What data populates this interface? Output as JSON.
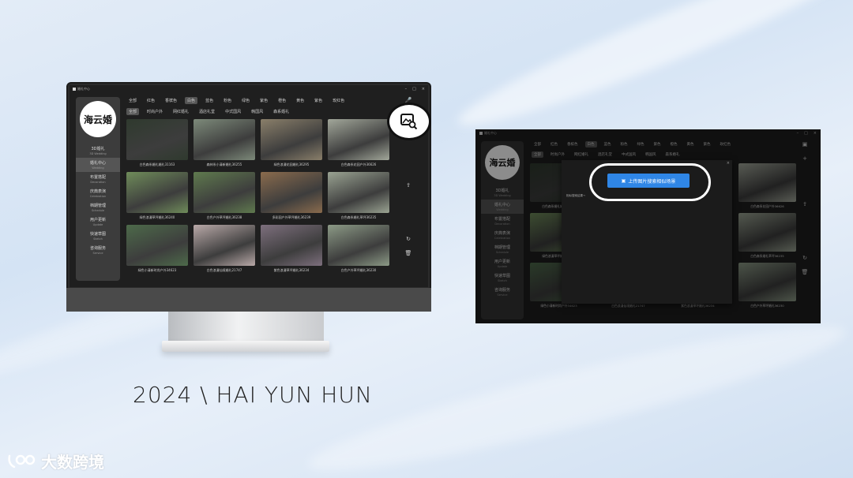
{
  "app": {
    "window_title": "婚礼中心",
    "brand_logo_text": "海云婚",
    "window_controls": [
      "–",
      "□",
      "×"
    ]
  },
  "sidebar": {
    "items": [
      {
        "zh": "3D婚礼",
        "en": "3D Wedding"
      },
      {
        "zh": "婚礼中心",
        "en": "Wedding"
      },
      {
        "zh": "布置搭配",
        "en": "Decoration"
      },
      {
        "zh": "庆典表演",
        "en": "Celebration"
      },
      {
        "zh": "档期管理",
        "en": "Schedule"
      },
      {
        "zh": "用户更新",
        "en": "Update"
      },
      {
        "zh": "快速草图",
        "en": "Sketch"
      },
      {
        "zh": "咨询服务",
        "en": "Service"
      }
    ],
    "active_index": 1
  },
  "color_tabs": [
    "全部",
    "红色",
    "香槟色",
    "白色",
    "蓝色",
    "粉色",
    "绿色",
    "紫色",
    "橙色",
    "黄色",
    "紫色",
    "玫红色"
  ],
  "color_tabs_active": 3,
  "style_tabs": [
    "全部",
    "时尚户外",
    "网红婚礼",
    "酒店礼堂",
    "中式国风",
    "韩国风",
    "森系婚礼"
  ],
  "style_tabs_active": 0,
  "cards": [
    {
      "caption": "白色森系婚礼婚礼31163",
      "color": "#2f3a2e"
    },
    {
      "caption": "森林系小清新婚礼36255",
      "color": "#7d8a7a"
    },
    {
      "caption": "绿色浪漫花园婚礼36295",
      "color": "#8a7f6a"
    },
    {
      "caption": "白色森系花园户外36626",
      "color": "#a2a79a"
    },
    {
      "caption": "绿色浪漫草坪婚礼36240",
      "color": "#6f8c5a"
    },
    {
      "caption": "白色户外草坪婚礼36238",
      "color": "#5f7a4e"
    },
    {
      "caption": "多彩园户外草坪婚礼36239",
      "color": "#8a6b4d"
    },
    {
      "caption": "白色森系婚礼草坪36235",
      "color": "#9aa392"
    },
    {
      "caption": "绿色小清新时尚户外34623",
      "color": "#4d6a4a"
    },
    {
      "caption": "白色浪漫仙境婚礼21747",
      "color": "#b9a9a8"
    },
    {
      "caption": "紫色浪漫草坪婚礼36234",
      "color": "#7d6f7d"
    },
    {
      "caption": "白色户外草坪婚礼36230",
      "color": "#8c9a86"
    }
  ],
  "modal": {
    "upload_button_label": "上传图片搜索相似场景",
    "hint": "相似搜索结果→",
    "close": "×"
  },
  "caption": "2024 \\ HAI YUN HUN",
  "watermark": "大数跨境",
  "icons": {
    "image_search": "image-search-icon",
    "add": "plus-icon",
    "export": "export-icon",
    "refresh": "refresh-icon",
    "trash": "trash-icon",
    "mic": "mic-icon",
    "settings": "gear-icon"
  }
}
